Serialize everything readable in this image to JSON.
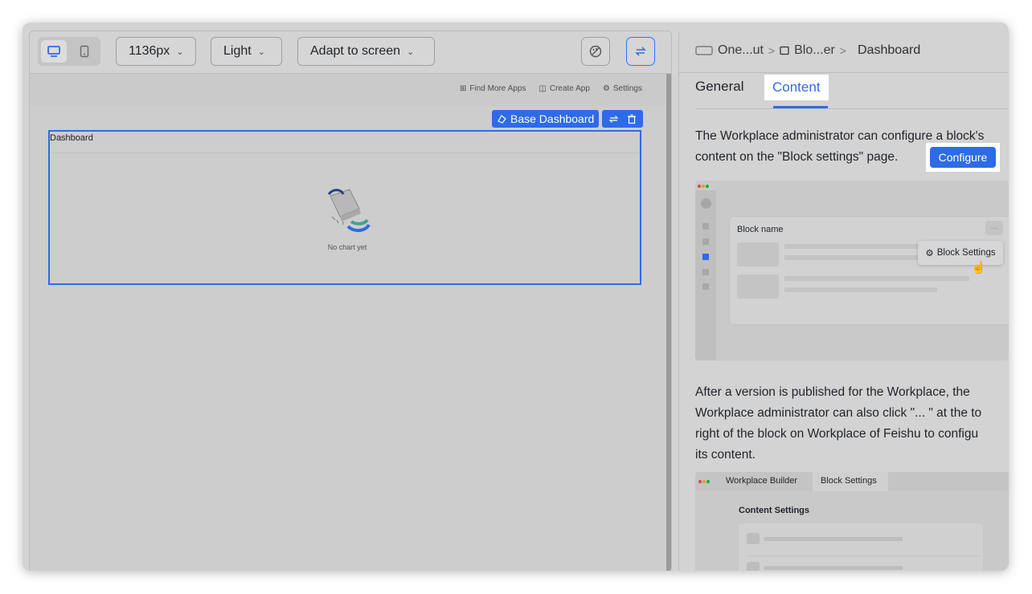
{
  "toolbar": {
    "width_label": "1136px",
    "theme_label": "Light",
    "adapt_label": "Adapt to screen"
  },
  "app_header": {
    "find_more_apps": "Find More Apps",
    "create_app": "Create App",
    "settings": "Settings"
  },
  "block": {
    "badge_label": "Base Dashboard",
    "title": "Dashboard",
    "empty_text": "No chart yet"
  },
  "right_panel": {
    "breadcrumb": [
      "One...ut",
      "Blo...er",
      "Dashboard"
    ],
    "tabs": [
      "General",
      "Content"
    ],
    "active_tab": "Content",
    "para1_line1": "The Workplace administrator can configure a block's",
    "para1_line2": "content on the \"Block settings\" page.",
    "configure_label": "Configure",
    "preview1": {
      "block_name": "Block name",
      "block_settings": "Block Settings",
      "more": "···"
    },
    "para2_lines": [
      "After a version is published for the Workplace, the",
      "Workplace administrator can also click \"... \" at the to",
      "right of the block on Workplace of Feishu to configu",
      "its content."
    ],
    "preview2": {
      "tab1": "Workplace Builder",
      "tab2": "Block Settings",
      "section": "Content Settings"
    }
  },
  "colors": {
    "accent": "#2e6be6",
    "overlay_gray": "#d3d3d3"
  }
}
